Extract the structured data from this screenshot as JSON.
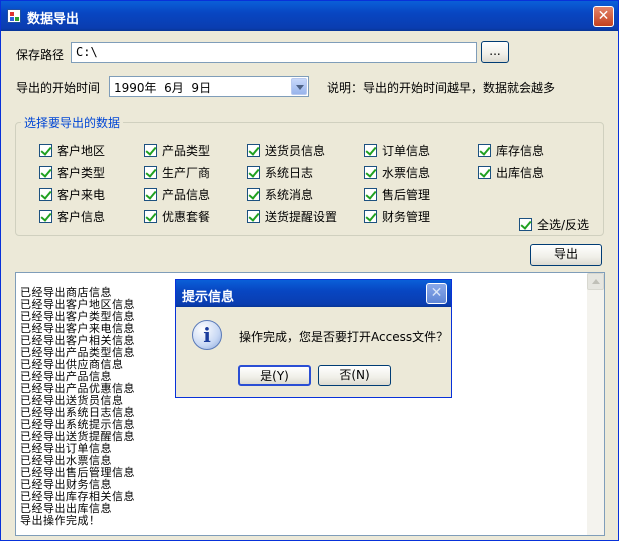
{
  "window": {
    "title": "数据导出",
    "close_glyph": "✕"
  },
  "form": {
    "save_path_label": "保存路径",
    "save_path_value": "C:\\",
    "browse_label": "...",
    "start_time_label": "导出的开始时间",
    "start_time_value": "1990年  6月  9日",
    "note": "说明：导出的开始时间越早，数据就会越多"
  },
  "group": {
    "title": "选择要导出的数据",
    "items": [
      "客户地区",
      "产品类型",
      "送货员信息",
      "订单信息",
      "库存信息",
      "客户类型",
      "生产厂商",
      "系统日志",
      "水票信息",
      "出库信息",
      "客户来电",
      "产品信息",
      "系统消息",
      "售后管理",
      "客户信息",
      "优惠套餐",
      "送货提醒设置",
      "财务管理"
    ],
    "select_all_label": "全选/反选"
  },
  "export_button": "导出",
  "log": [
    "已经导出商店信息",
    "已经导出客户地区信息",
    "已经导出客户类型信息",
    "已经导出客户来电信息",
    "已经导出客户相关信息",
    "已经导出产品类型信息",
    "已经导出供应商信息",
    "已经导出产品信息",
    "已经导出产品优惠信息",
    "已经导出送货员信息",
    "已经导出系统日志信息",
    "已经导出系统提示信息",
    "已经导出送货提醒信息",
    "已经导出订单信息",
    "已经导出水票信息",
    "已经导出售后管理信息",
    "已经导出财务信息",
    "已经导出库存相关信息",
    "已经导出出库信息",
    "导出操作完成！"
  ],
  "dialog": {
    "title": "提示信息",
    "close_glyph": "✕",
    "message": "操作完成，您是否要打开Access文件？",
    "icon_glyph": "i",
    "yes_label": "是(Y)",
    "no_label": "否(N)"
  },
  "icons": {
    "app": "app-icon",
    "dialog": "info-icon",
    "combo": "chevron-down-icon"
  }
}
